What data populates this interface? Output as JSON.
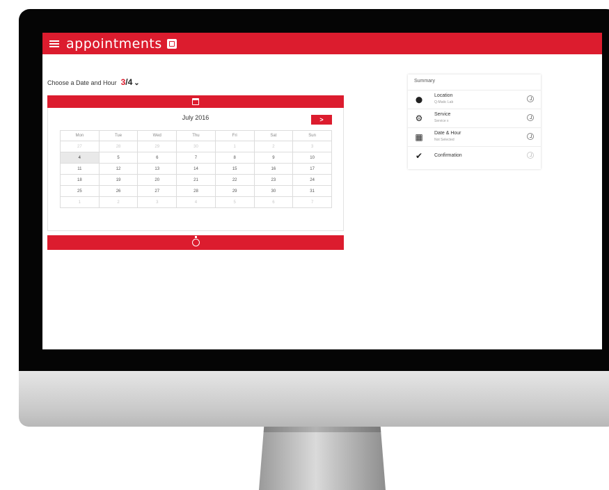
{
  "app": {
    "title": "appointments",
    "brand_color": "#dc1c2e"
  },
  "step": {
    "label": "Choose a Date and Hour",
    "current": "3",
    "total": "/4",
    "chevron": "⌵"
  },
  "calendar": {
    "month_label": "July 2016",
    "next_label": ">",
    "weekdays": [
      "Mon",
      "Tue",
      "Wed",
      "Thu",
      "Fri",
      "Sat",
      "Sun"
    ],
    "weeks": [
      [
        {
          "d": "27",
          "m": true
        },
        {
          "d": "28",
          "m": true
        },
        {
          "d": "29",
          "m": true
        },
        {
          "d": "30",
          "m": true
        },
        {
          "d": "1",
          "m": true
        },
        {
          "d": "2",
          "m": true
        },
        {
          "d": "3",
          "m": true
        }
      ],
      [
        {
          "d": "4",
          "s": true
        },
        {
          "d": "5"
        },
        {
          "d": "6"
        },
        {
          "d": "7"
        },
        {
          "d": "8"
        },
        {
          "d": "9"
        },
        {
          "d": "10"
        }
      ],
      [
        {
          "d": "11"
        },
        {
          "d": "12"
        },
        {
          "d": "13"
        },
        {
          "d": "14"
        },
        {
          "d": "15"
        },
        {
          "d": "16"
        },
        {
          "d": "17"
        }
      ],
      [
        {
          "d": "18"
        },
        {
          "d": "19"
        },
        {
          "d": "20"
        },
        {
          "d": "21"
        },
        {
          "d": "22"
        },
        {
          "d": "23"
        },
        {
          "d": "24"
        }
      ],
      [
        {
          "d": "25"
        },
        {
          "d": "26"
        },
        {
          "d": "27"
        },
        {
          "d": "28"
        },
        {
          "d": "29"
        },
        {
          "d": "30"
        },
        {
          "d": "31"
        }
      ],
      [
        {
          "d": "1",
          "m": true
        },
        {
          "d": "2",
          "m": true
        },
        {
          "d": "3",
          "m": true
        },
        {
          "d": "4",
          "m": true
        },
        {
          "d": "5",
          "m": true
        },
        {
          "d": "6",
          "m": true
        },
        {
          "d": "7",
          "m": true
        }
      ]
    ]
  },
  "summary": {
    "title": "Summary",
    "items": [
      {
        "label": "Location",
        "sub": "Q-Matic Lab",
        "icon": "map-pin-icon"
      },
      {
        "label": "Service",
        "sub": "Service x",
        "icon": "gear-icon"
      },
      {
        "label": "Date & Hour",
        "sub": "Not Selected",
        "icon": "calendar-icon"
      },
      {
        "label": "Confirmation",
        "sub": "",
        "icon": "checkmark-icon"
      }
    ]
  }
}
